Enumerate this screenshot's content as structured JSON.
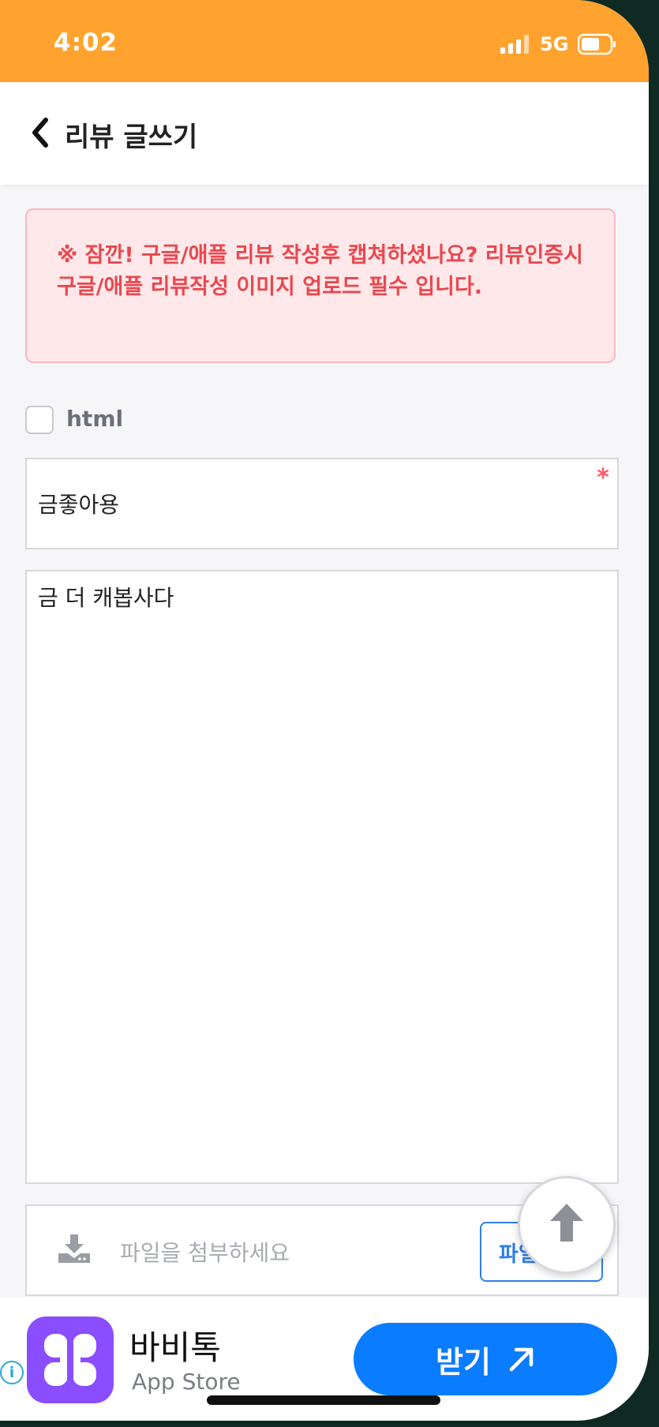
{
  "status_bar": {
    "time": "4:02",
    "network": "5G"
  },
  "header": {
    "title": "리뷰 글쓰기"
  },
  "notice": {
    "text": "※ 잠깐! 구글/애플 리뷰 작성후 캡쳐하셨나요? 리뷰인증시 구글/애플 리뷰작성 이미지 업로드 필수 입니다."
  },
  "form": {
    "html_label": "html",
    "title_value": "금좋아용",
    "required_mark": "*",
    "content_value": "금 더 캐봅사다",
    "file_placeholder": "파일을 첨부하세요",
    "file_button_label": "파일"
  },
  "ad": {
    "app_name": "바비톡",
    "store": "App Store",
    "get_label": "받기"
  },
  "colors": {
    "status_bar": "#ffa32e",
    "notice_text": "#e8484f",
    "notice_bg": "#ffe8ea",
    "accent_blue": "#2f7ee8",
    "app_icon": "#8a4dff",
    "get_button": "#0a7cff"
  },
  "icons": {
    "back": "chevron-left-icon",
    "download": "download-icon",
    "scroll_top": "arrow-up-icon",
    "external": "arrow-up-right-icon",
    "info": "info-icon"
  }
}
